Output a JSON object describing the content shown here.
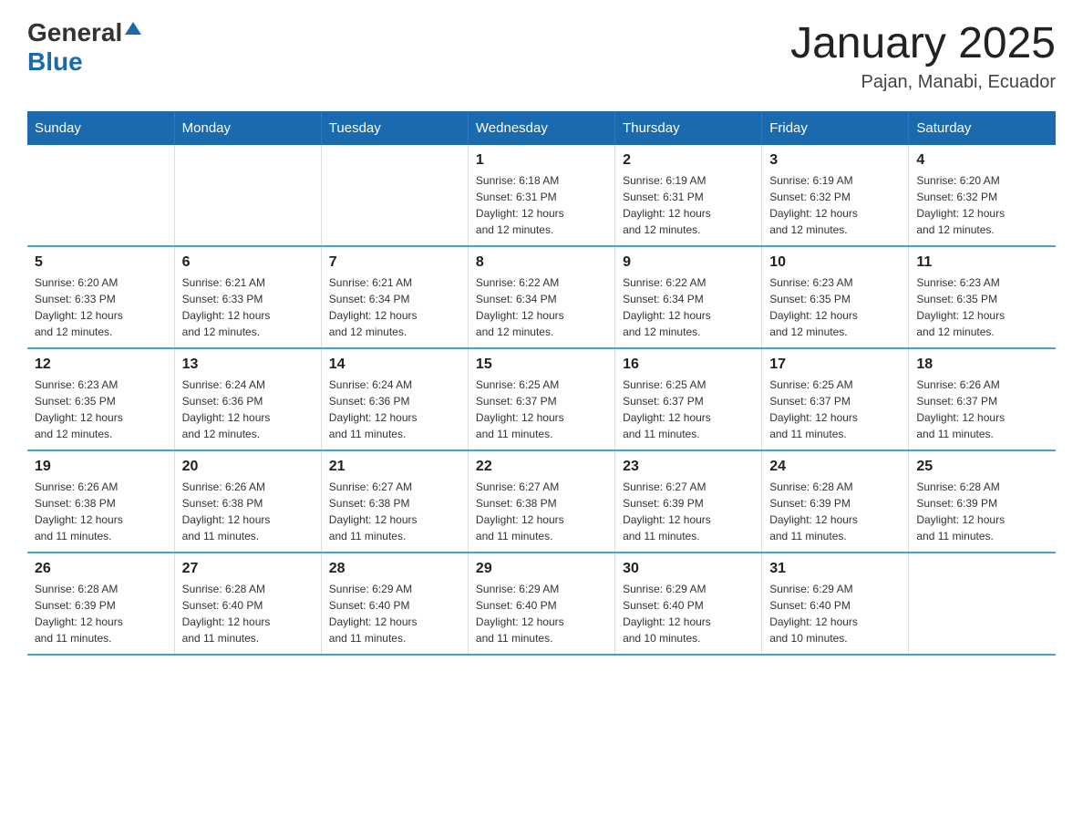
{
  "header": {
    "logo": {
      "general": "General",
      "blue": "Blue"
    },
    "title": "January 2025",
    "subtitle": "Pajan, Manabi, Ecuador"
  },
  "days_of_week": [
    "Sunday",
    "Monday",
    "Tuesday",
    "Wednesday",
    "Thursday",
    "Friday",
    "Saturday"
  ],
  "weeks": [
    [
      {
        "day": "",
        "info": ""
      },
      {
        "day": "",
        "info": ""
      },
      {
        "day": "",
        "info": ""
      },
      {
        "day": "1",
        "info": "Sunrise: 6:18 AM\nSunset: 6:31 PM\nDaylight: 12 hours\nand 12 minutes."
      },
      {
        "day": "2",
        "info": "Sunrise: 6:19 AM\nSunset: 6:31 PM\nDaylight: 12 hours\nand 12 minutes."
      },
      {
        "day": "3",
        "info": "Sunrise: 6:19 AM\nSunset: 6:32 PM\nDaylight: 12 hours\nand 12 minutes."
      },
      {
        "day": "4",
        "info": "Sunrise: 6:20 AM\nSunset: 6:32 PM\nDaylight: 12 hours\nand 12 minutes."
      }
    ],
    [
      {
        "day": "5",
        "info": "Sunrise: 6:20 AM\nSunset: 6:33 PM\nDaylight: 12 hours\nand 12 minutes."
      },
      {
        "day": "6",
        "info": "Sunrise: 6:21 AM\nSunset: 6:33 PM\nDaylight: 12 hours\nand 12 minutes."
      },
      {
        "day": "7",
        "info": "Sunrise: 6:21 AM\nSunset: 6:34 PM\nDaylight: 12 hours\nand 12 minutes."
      },
      {
        "day": "8",
        "info": "Sunrise: 6:22 AM\nSunset: 6:34 PM\nDaylight: 12 hours\nand 12 minutes."
      },
      {
        "day": "9",
        "info": "Sunrise: 6:22 AM\nSunset: 6:34 PM\nDaylight: 12 hours\nand 12 minutes."
      },
      {
        "day": "10",
        "info": "Sunrise: 6:23 AM\nSunset: 6:35 PM\nDaylight: 12 hours\nand 12 minutes."
      },
      {
        "day": "11",
        "info": "Sunrise: 6:23 AM\nSunset: 6:35 PM\nDaylight: 12 hours\nand 12 minutes."
      }
    ],
    [
      {
        "day": "12",
        "info": "Sunrise: 6:23 AM\nSunset: 6:35 PM\nDaylight: 12 hours\nand 12 minutes."
      },
      {
        "day": "13",
        "info": "Sunrise: 6:24 AM\nSunset: 6:36 PM\nDaylight: 12 hours\nand 12 minutes."
      },
      {
        "day": "14",
        "info": "Sunrise: 6:24 AM\nSunset: 6:36 PM\nDaylight: 12 hours\nand 11 minutes."
      },
      {
        "day": "15",
        "info": "Sunrise: 6:25 AM\nSunset: 6:37 PM\nDaylight: 12 hours\nand 11 minutes."
      },
      {
        "day": "16",
        "info": "Sunrise: 6:25 AM\nSunset: 6:37 PM\nDaylight: 12 hours\nand 11 minutes."
      },
      {
        "day": "17",
        "info": "Sunrise: 6:25 AM\nSunset: 6:37 PM\nDaylight: 12 hours\nand 11 minutes."
      },
      {
        "day": "18",
        "info": "Sunrise: 6:26 AM\nSunset: 6:37 PM\nDaylight: 12 hours\nand 11 minutes."
      }
    ],
    [
      {
        "day": "19",
        "info": "Sunrise: 6:26 AM\nSunset: 6:38 PM\nDaylight: 12 hours\nand 11 minutes."
      },
      {
        "day": "20",
        "info": "Sunrise: 6:26 AM\nSunset: 6:38 PM\nDaylight: 12 hours\nand 11 minutes."
      },
      {
        "day": "21",
        "info": "Sunrise: 6:27 AM\nSunset: 6:38 PM\nDaylight: 12 hours\nand 11 minutes."
      },
      {
        "day": "22",
        "info": "Sunrise: 6:27 AM\nSunset: 6:38 PM\nDaylight: 12 hours\nand 11 minutes."
      },
      {
        "day": "23",
        "info": "Sunrise: 6:27 AM\nSunset: 6:39 PM\nDaylight: 12 hours\nand 11 minutes."
      },
      {
        "day": "24",
        "info": "Sunrise: 6:28 AM\nSunset: 6:39 PM\nDaylight: 12 hours\nand 11 minutes."
      },
      {
        "day": "25",
        "info": "Sunrise: 6:28 AM\nSunset: 6:39 PM\nDaylight: 12 hours\nand 11 minutes."
      }
    ],
    [
      {
        "day": "26",
        "info": "Sunrise: 6:28 AM\nSunset: 6:39 PM\nDaylight: 12 hours\nand 11 minutes."
      },
      {
        "day": "27",
        "info": "Sunrise: 6:28 AM\nSunset: 6:40 PM\nDaylight: 12 hours\nand 11 minutes."
      },
      {
        "day": "28",
        "info": "Sunrise: 6:29 AM\nSunset: 6:40 PM\nDaylight: 12 hours\nand 11 minutes."
      },
      {
        "day": "29",
        "info": "Sunrise: 6:29 AM\nSunset: 6:40 PM\nDaylight: 12 hours\nand 11 minutes."
      },
      {
        "day": "30",
        "info": "Sunrise: 6:29 AM\nSunset: 6:40 PM\nDaylight: 12 hours\nand 10 minutes."
      },
      {
        "day": "31",
        "info": "Sunrise: 6:29 AM\nSunset: 6:40 PM\nDaylight: 12 hours\nand 10 minutes."
      },
      {
        "day": "",
        "info": ""
      }
    ]
  ]
}
